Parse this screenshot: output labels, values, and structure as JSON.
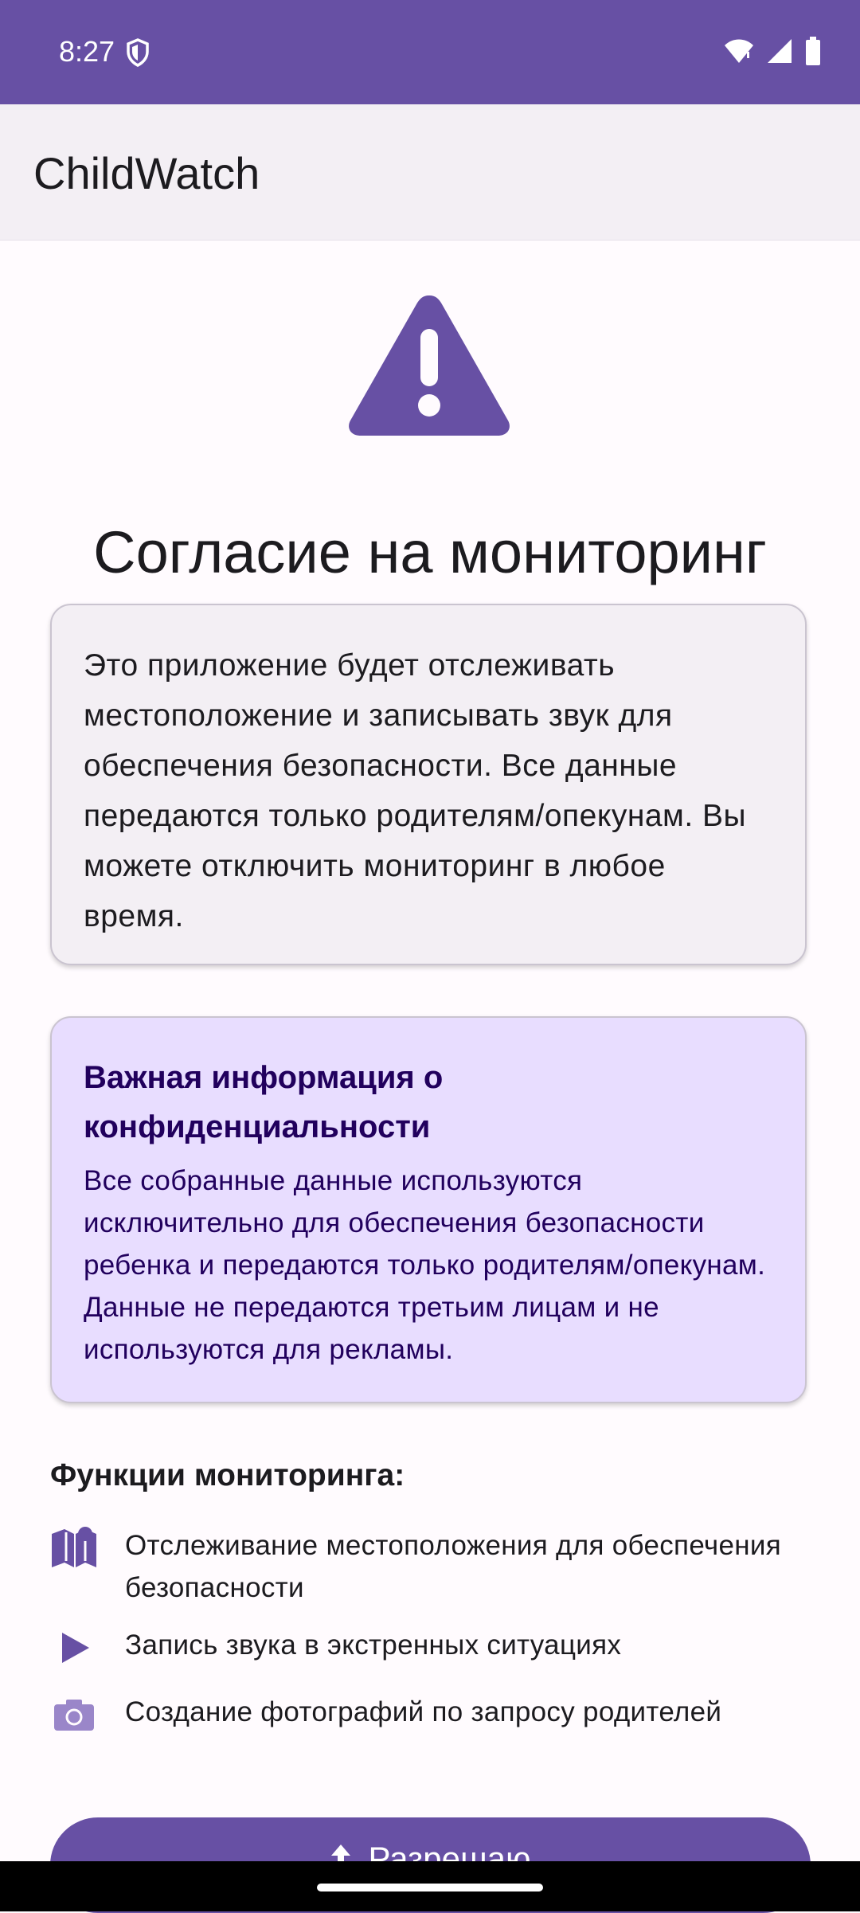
{
  "status_bar": {
    "time": "8:27",
    "icons": [
      "shield-icon",
      "wifi-icon",
      "signal-icon",
      "battery-icon"
    ]
  },
  "app_bar": {
    "title": "ChildWatch"
  },
  "consent": {
    "icon": "warning-icon",
    "title": "Согласие на мониторинг",
    "description": "Это приложение будет отслеживать местоположение и записывать звук для обеспечения безопасности. Все данные передаются только родителям/опекунам. Вы можете отключить мониторинг в любое время."
  },
  "privacy": {
    "heading": "Важная информация о конфиденциальности",
    "text": "Все собранные данные используются исключительно для обеспечения безопасности ребенка и передаются только родителям/опекунам. Данные не передаются третьим лицам и не используются для рекламы."
  },
  "features": {
    "heading": "Функции мониторинга:",
    "items": [
      {
        "icon": "map-icon",
        "label": "Отслеживание местоположения для обеспечения безопасности"
      },
      {
        "icon": "play-icon",
        "label": "Запись звука в экстренных ситуациях"
      },
      {
        "icon": "camera-icon",
        "label": "Создание фотографий по запросу родителей"
      }
    ]
  },
  "actions": {
    "allow_label": "Разрешаю",
    "allow_icon": "arrow-up-icon"
  },
  "colors": {
    "primary": "#6750a4",
    "surface": "#fffbfe",
    "card_surface": "#f3eff4",
    "privacy_container": "#e8ddff",
    "on_privacy_container": "#21005d"
  }
}
